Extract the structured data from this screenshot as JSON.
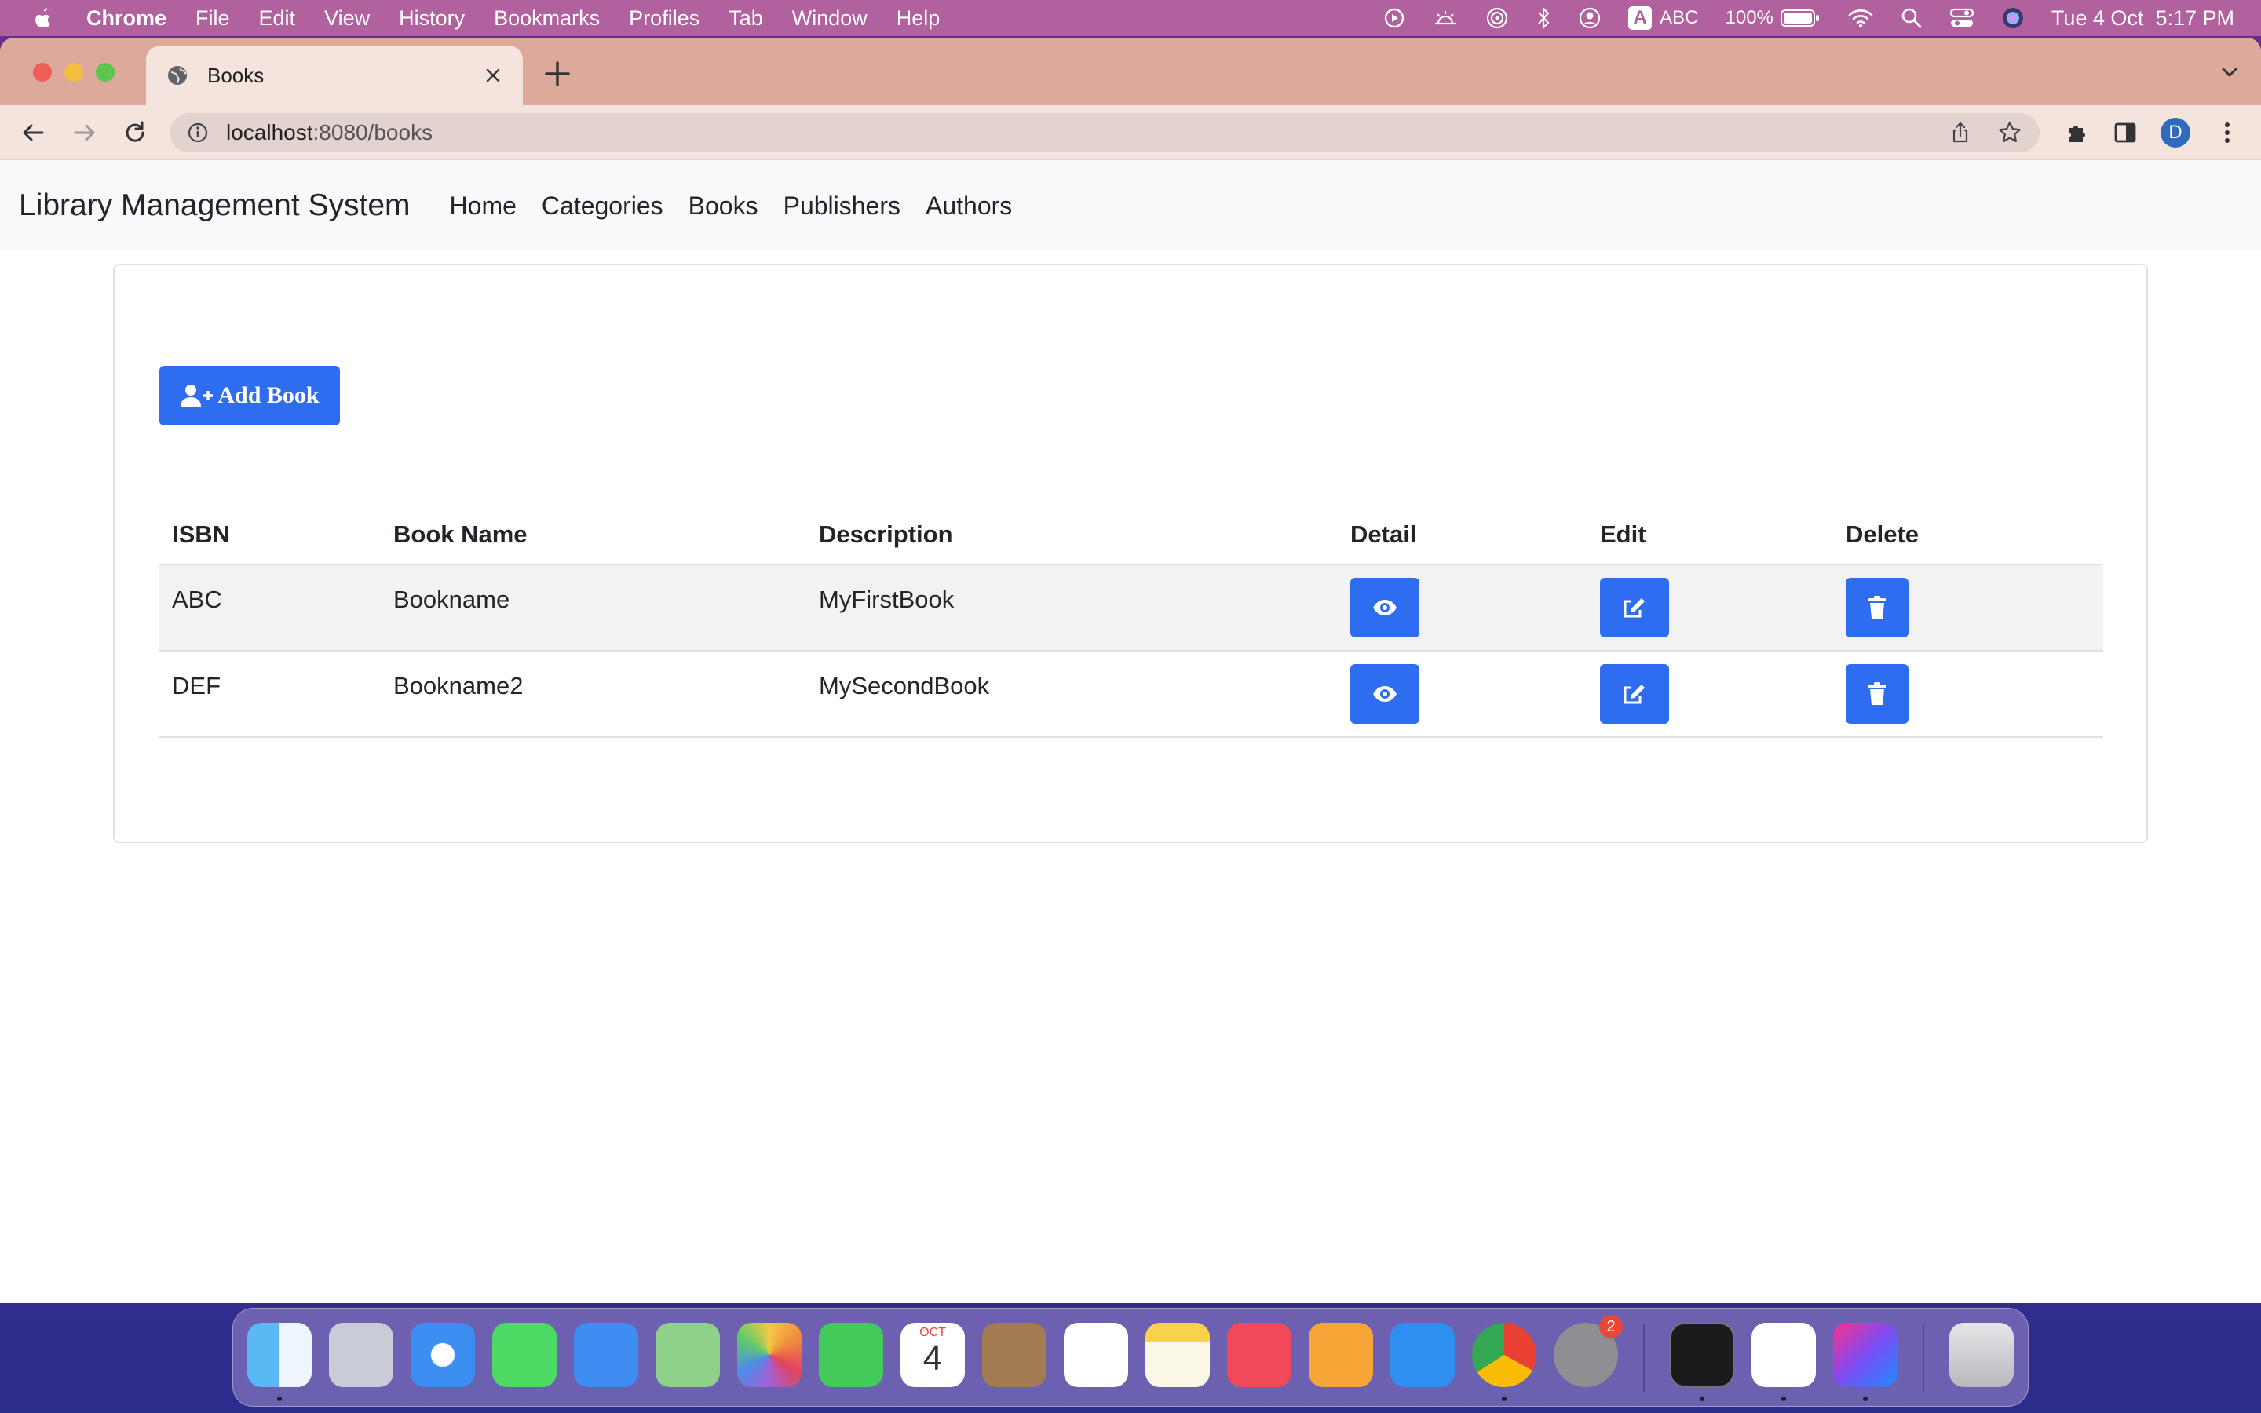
{
  "menubar": {
    "app_name": "Chrome",
    "items": [
      "File",
      "Edit",
      "View",
      "History",
      "Bookmarks",
      "Profiles",
      "Tab",
      "Window",
      "Help"
    ],
    "input_source": "ABC",
    "battery": "100%",
    "datetime": "Tue 4 Oct  5:17 PM"
  },
  "browser": {
    "tab_title": "Books",
    "url_host": "localhost",
    "url_rest": ":8080/books",
    "profile_initial": "D"
  },
  "navbar": {
    "brand": "Library Management System",
    "links": [
      "Home",
      "Categories",
      "Books",
      "Publishers",
      "Authors"
    ]
  },
  "content": {
    "add_button_label": "Add Book",
    "table": {
      "headers": [
        "ISBN",
        "Book Name",
        "Description",
        "Detail",
        "Edit",
        "Delete"
      ],
      "rows": [
        {
          "isbn": "ABC",
          "name": "Bookname",
          "description": "MyFirstBook"
        },
        {
          "isbn": "DEF",
          "name": "Bookname2",
          "description": "MySecondBook"
        }
      ]
    }
  },
  "dock": {
    "calendar_month": "OCT",
    "calendar_day": "4",
    "system_settings_badge": "2"
  },
  "colors": {
    "primary": "#2f6df0",
    "menubar": "#b0619e",
    "tabstrip": "#dda99a",
    "navbar_bg": "#f8f9fa"
  }
}
